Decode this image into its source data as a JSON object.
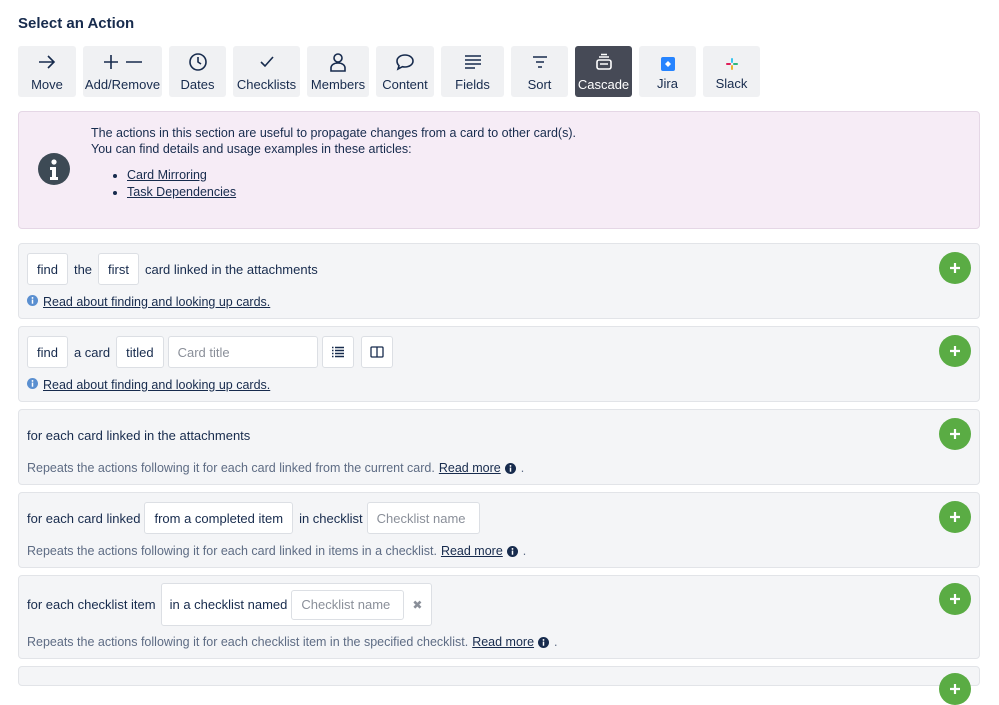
{
  "heading": "Select an Action",
  "toolbar": [
    {
      "label": "Move",
      "icon": "arrow-right-icon"
    },
    {
      "label": "Add/Remove",
      "icon": "plus-minus-icon"
    },
    {
      "label": "Dates",
      "icon": "clock-icon"
    },
    {
      "label": "Checklists",
      "icon": "checkmark-icon"
    },
    {
      "label": "Members",
      "icon": "person-icon"
    },
    {
      "label": "Content",
      "icon": "speech-bubble-icon"
    },
    {
      "label": "Fields",
      "icon": "fields-icon"
    },
    {
      "label": "Sort",
      "icon": "sort-icon"
    },
    {
      "label": "Cascade",
      "icon": "cascade-icon",
      "active": true
    },
    {
      "label": "Jira",
      "icon": "jira-icon"
    },
    {
      "label": "Slack",
      "icon": "slack-icon"
    }
  ],
  "info": {
    "line1": "The actions in this section are useful to propagate changes from a card to other card(s).",
    "line2": "You can find details and usage examples in these articles:",
    "links": [
      "Card Mirroring",
      "Task Dependencies"
    ]
  },
  "cards": {
    "find_linked": {
      "find": "find",
      "the": "the",
      "first": "first",
      "rest": "card linked in the attachments",
      "help": "Read about finding and looking up cards."
    },
    "find_titled": {
      "find": "find",
      "a_card": "a card",
      "titled": "titled",
      "placeholder": "Card title",
      "help": "Read about finding and looking up cards."
    },
    "foreach_attach": {
      "title": "for each card linked in the attachments",
      "desc": "Repeats the actions following it for each card linked from the current card.",
      "more": "Read more",
      "dot": "."
    },
    "foreach_checklist": {
      "lead": "for each card linked",
      "from": "from a completed item",
      "in_checklist": "in checklist",
      "placeholder": "Checklist name",
      "desc": "Repeats the actions following it for each card linked in items in a checklist.",
      "more": "Read more",
      "dot": "."
    },
    "foreach_item": {
      "lead": "for each checklist item",
      "named": "in a checklist named",
      "placeholder": "Checklist name",
      "clear": "✖",
      "desc": "Repeats the actions following it for each checklist item in the specified checklist.",
      "more": "Read more",
      "dot": "."
    }
  },
  "colors": {
    "accent_green": "#5aac44",
    "active_tab": "#464a56",
    "info_bg": "#f6ecf6"
  }
}
